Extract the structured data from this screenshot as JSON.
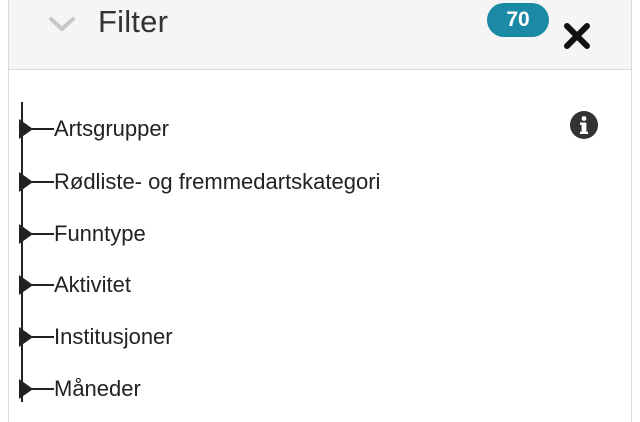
{
  "header": {
    "title": "Filter",
    "count_badge": "70",
    "chevron_icon": "chevron-down-icon",
    "close_icon": "close-icon"
  },
  "info_icon": "info-icon",
  "filters": [
    {
      "label": "Artsgrupper"
    },
    {
      "label": "Rødliste- og fremmedartskategori"
    },
    {
      "label": "Funntype"
    },
    {
      "label": "Aktivitet"
    },
    {
      "label": "Institusjoner"
    },
    {
      "label": "Måneder"
    }
  ],
  "colors": {
    "badge": "#1b8aa5",
    "header_bg": "#f5f5f5",
    "text": "#222222"
  }
}
